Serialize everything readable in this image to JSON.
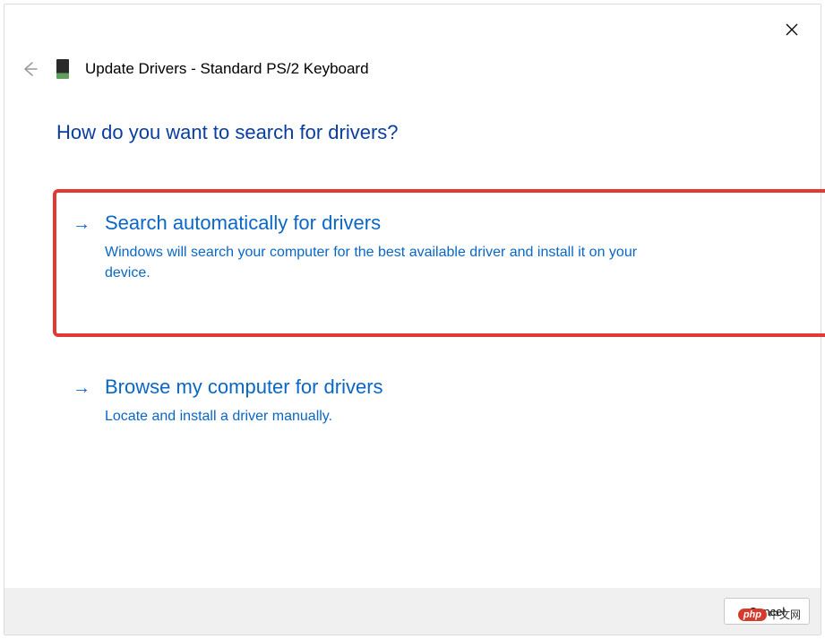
{
  "dialog": {
    "title": "Update Drivers - Standard PS/2 Keyboard",
    "question": "How do you want to search for drivers?",
    "options": [
      {
        "title": "Search automatically for drivers",
        "description": "Windows will search your computer for the best available driver and install it on your device.",
        "highlighted": true
      },
      {
        "title": "Browse my computer for drivers",
        "description": "Locate and install a driver manually.",
        "highlighted": false
      }
    ],
    "cancel_label": "Cancel"
  },
  "watermark": {
    "badge": "php",
    "text": "中文网"
  }
}
